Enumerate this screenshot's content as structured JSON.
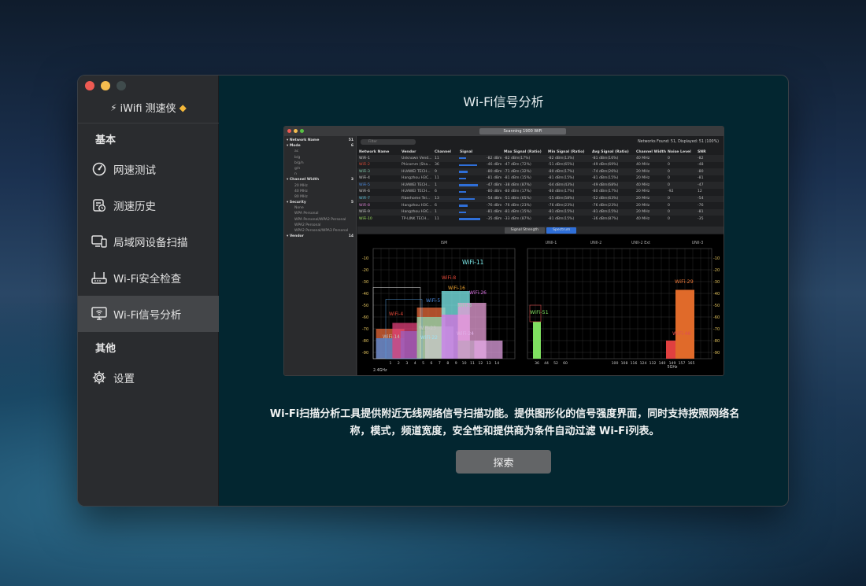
{
  "window": {
    "app_name": "iWifi 测速侠"
  },
  "sidebar": {
    "section_basic": "基本",
    "section_other": "其他",
    "items": [
      {
        "label": "网速测试",
        "icon": "speedometer-icon"
      },
      {
        "label": "测速历史",
        "icon": "history-icon"
      },
      {
        "label": "局域网设备扫描",
        "icon": "devices-icon"
      },
      {
        "label": "Wi-Fi安全检查",
        "icon": "router-icon"
      },
      {
        "label": "Wi-Fi信号分析",
        "icon": "wifi-monitor-icon",
        "active": true
      },
      {
        "label": "设置",
        "icon": "gear-icon"
      }
    ]
  },
  "main": {
    "title": "Wi-Fi信号分析",
    "description": "Wi-Fi扫描分析工具提供附近无线网络信号扫描功能。提供图形化的信号强度界面，同时支持按照网络名称，模式，频道宽度，安全性和提供商为条件自动过滤 Wi-Fi列表。",
    "button_label": "探索"
  },
  "screenshot": {
    "title": "Scanning 1900 WiFi",
    "found": "Networks Found: 51, Displayed: 51 (100%)",
    "search_placeholder": "Filter",
    "filters": [
      {
        "label": "Network Name",
        "count": "51",
        "header": true
      },
      {
        "label": "Mode",
        "count": "6",
        "header": true
      },
      {
        "label": "ac",
        "sub": true
      },
      {
        "label": "b/g",
        "sub": true
      },
      {
        "label": "b/g/n",
        "sub": true
      },
      {
        "label": "g/n",
        "sub": true
      },
      {
        "label": "n",
        "sub": true
      },
      {
        "label": "Channel Width",
        "count": "3",
        "header": true
      },
      {
        "label": "20 MHz",
        "sub": true
      },
      {
        "label": "40 MHz",
        "sub": true
      },
      {
        "label": "80 MHz",
        "sub": true
      },
      {
        "label": "Security",
        "count": "5",
        "header": true
      },
      {
        "label": "None",
        "sub": true
      },
      {
        "label": "WPA Personal",
        "sub": true
      },
      {
        "label": "WPA Personal/WPA2 Personal",
        "sub": true
      },
      {
        "label": "WPA2 Personal",
        "sub": true
      },
      {
        "label": "WPA2 Personal/WPA3 Personal",
        "sub": true
      },
      {
        "label": "Vendor",
        "count": "14",
        "header": true
      }
    ],
    "columns": [
      "Network Name",
      "Vendor",
      "Channel",
      "Signal",
      "Max Signal (Ratio)",
      "Min Signal (Ratio)",
      "Avg Signal (Ratio)",
      "Channel Width",
      "Noise Level",
      "SNR"
    ],
    "rows": [
      {
        "name": "WiFi-1",
        "vendor": "Unknown Vend...",
        "ch": "11",
        "sig": "-82 dBm",
        "max": "-82 dBm(17%)",
        "min": "-82 dBm(13%)",
        "avg": "-81 dBm(16%)",
        "width": "40 MHz",
        "noise": "0",
        "snr": "-82",
        "bar": 0.3,
        "color": "#c8c8c8"
      },
      {
        "name": "WiFi-2",
        "vendor": "Phicomm (Sha...",
        "ch": "36",
        "sig": "-46 dBm",
        "max": "-47 dBm (72%)",
        "min": "-51 dBm(65%)",
        "avg": "-49 dBm(69%)",
        "width": "40 MHz",
        "noise": "0",
        "snr": "-48",
        "bar": 0.75,
        "color": "#e0503a"
      },
      {
        "name": "WiFi-3",
        "vendor": "HUAWEI TECH...",
        "ch": "9",
        "sig": "-80 dBm",
        "max": "-71 dBm (32%)",
        "min": "-80 dBm(17%)",
        "avg": "-74 dBm(26%)",
        "width": "20 MHz",
        "noise": "0",
        "snr": "-80",
        "bar": 0.35,
        "color": "#7ec8a8"
      },
      {
        "name": "WiFi-4",
        "vendor": "Hangzhou H3C...",
        "ch": "11",
        "sig": "-81 dBm",
        "max": "-81 dBm (15%)",
        "min": "-81 dBm(15%)",
        "avg": "-81 dBm(15%)",
        "width": "20 MHz",
        "noise": "0",
        "snr": "-81",
        "bar": 0.3,
        "color": "#c8c8c8"
      },
      {
        "name": "WiFi-5",
        "vendor": "HUAWEI TECH...",
        "ch": "1",
        "sig": "-47 dBm",
        "max": "-38 dBm (87%)",
        "min": "-64 dBm(43%)",
        "avg": "-49 dBm(68%)",
        "width": "40 MHz",
        "noise": "0",
        "snr": "-47",
        "bar": 0.8,
        "color": "#4a8ae0"
      },
      {
        "name": "WiFi-6",
        "vendor": "HUAWEI TECH...",
        "ch": "6",
        "sig": "-80 dBm",
        "max": "-80 dBm (17%)",
        "min": "-80 dBm(17%)",
        "avg": "-80 dBm(17%)",
        "width": "20 MHz",
        "noise": "-92",
        "snr": "12",
        "bar": 0.3,
        "color": "#c8c8c8"
      },
      {
        "name": "WiFi-7",
        "vendor": "Fiberhome Tel...",
        "ch": "13",
        "sig": "-54 dBm",
        "max": "-51 dBm (65%)",
        "min": "-55 dBm(58%)",
        "avg": "-52 dBm(63%)",
        "width": "20 MHz",
        "noise": "0",
        "snr": "-54",
        "bar": 0.65,
        "color": "#60c0d8"
      },
      {
        "name": "WiFi-8",
        "vendor": "Hangzhou H3C...",
        "ch": "6",
        "sig": "-76 dBm",
        "max": "-76 dBm (23%)",
        "min": "-76 dBm(23%)",
        "avg": "-76 dBm(23%)",
        "width": "20 MHz",
        "noise": "0",
        "snr": "-76",
        "bar": 0.35,
        "color": "#d880d0"
      },
      {
        "name": "WiFi-9",
        "vendor": "Hangzhou H3C...",
        "ch": "1",
        "sig": "-81 dBm",
        "max": "-81 dBm (15%)",
        "min": "-81 dBm(15%)",
        "avg": "-81 dBm(15%)",
        "width": "20 MHz",
        "noise": "0",
        "snr": "-81",
        "bar": 0.3,
        "color": "#c8c8c8"
      },
      {
        "name": "WiFi-10",
        "vendor": "TP-LINK TECH...",
        "ch": "11",
        "sig": "-35 dBm",
        "max": "-33 dBm (87%)",
        "min": "-81 dBm(15%)",
        "avg": "-36 dBm(87%)",
        "width": "40 MHz",
        "noise": "0",
        "snr": "-35",
        "bar": 0.9,
        "color": "#9be060"
      }
    ],
    "tabs": [
      "Signal Strength",
      "Spectrum"
    ],
    "band_labels": [
      "ISM",
      "UNII-1",
      "UNII-2",
      "UNII-2 Ext",
      "UNII-3"
    ],
    "y_ticks": [
      "-10",
      "-20",
      "-30",
      "-40",
      "-50",
      "-60",
      "-70",
      "-80",
      "-90"
    ],
    "x_ticks_24": [
      "1",
      "2",
      "3",
      "4",
      "5",
      "6",
      "7",
      "8",
      "9",
      "10",
      "11",
      "12",
      "13",
      "14"
    ],
    "x_ticks_5": [
      "36",
      "44",
      "52",
      "60",
      "100",
      "108",
      "116",
      "124",
      "132",
      "140",
      "149",
      "157",
      "165"
    ],
    "band_24_label": "2.4GHz",
    "band_5_label": "5GHz",
    "labels_24": [
      {
        "text": "WiFi-11",
        "color": "#7ff0f0"
      },
      {
        "text": "WiFi-8",
        "color": "#e84a3a"
      },
      {
        "text": "WiFi-16",
        "color": "#e8a030"
      },
      {
        "text": "WiFi-26",
        "color": "#d870e0"
      },
      {
        "text": "WiFi-3",
        "color": "#8fd8b0"
      },
      {
        "text": "WiFi-4",
        "color": "#e84a3a"
      },
      {
        "text": "WiFi-5",
        "color": "#4a8ae0"
      },
      {
        "text": "WiFi-23",
        "color": "#c8c8c8"
      },
      {
        "text": "WiFi-22",
        "color": "#9ee0f0"
      },
      {
        "text": "WiFi-24",
        "color": "#e0b0e8"
      },
      {
        "text": "WiFi-14",
        "color": "#c0c0c0"
      }
    ],
    "labels_5": [
      {
        "text": "WiFi-51",
        "color": "#7fe060"
      },
      {
        "text": "WiFi-29",
        "color": "#f07a3a"
      },
      {
        "text": "WiFi-46",
        "color": "#e05050"
      }
    ]
  }
}
